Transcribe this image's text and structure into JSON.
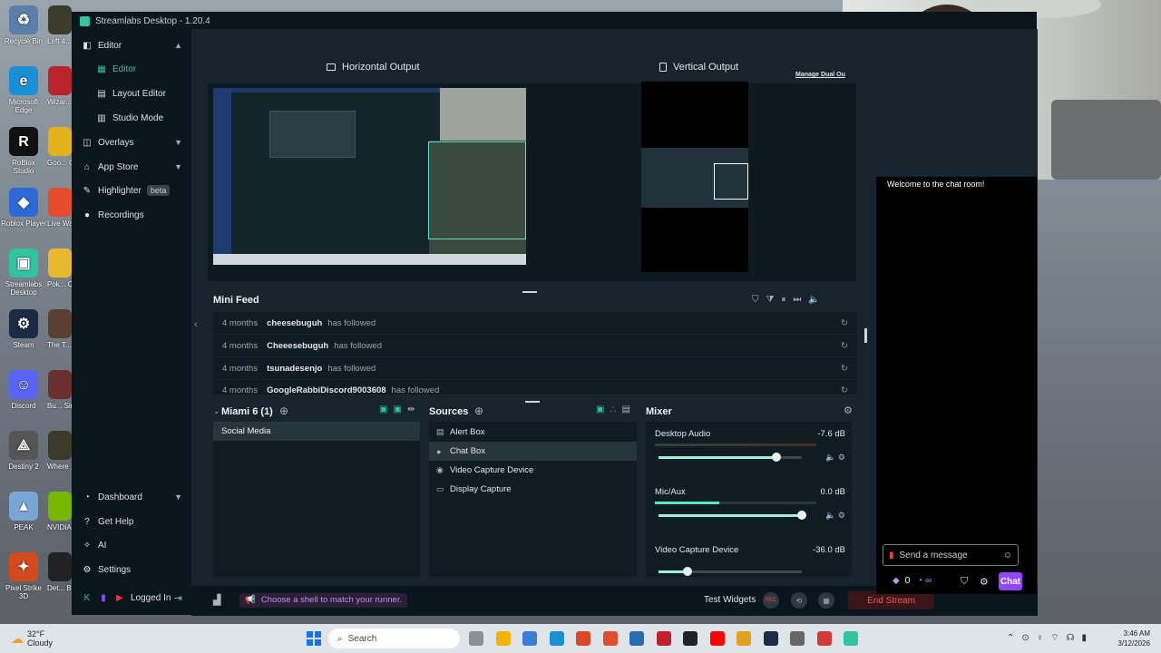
{
  "window": {
    "title": "Streamlabs Desktop - 1.20.4"
  },
  "desktop_icons": [
    {
      "label": "Recycle Bin",
      "color": "#5b7fa8",
      "glyph": "♻"
    },
    {
      "label": "Microsoft Edge",
      "color": "#1b8fd4",
      "glyph": "e"
    },
    {
      "label": "RoBlox Studio",
      "color": "#111111",
      "glyph": "R"
    },
    {
      "label": "Roblox Player",
      "color": "#2d6ad8",
      "glyph": "◆"
    },
    {
      "label": "Streamlabs Desktop",
      "color": "#31c3a2",
      "glyph": "▣"
    },
    {
      "label": "Steam",
      "color": "#1a2b43",
      "glyph": "⚙"
    },
    {
      "label": "Discord",
      "color": "#5865f2",
      "glyph": "☺"
    },
    {
      "label": "Destiny 2",
      "color": "#555555",
      "glyph": "⟁"
    },
    {
      "label": "PEAK",
      "color": "#7aa6d6",
      "glyph": "▲"
    },
    {
      "label": "Pixel Strike 3D",
      "color": "#d24a1e",
      "glyph": "✦"
    }
  ],
  "desktop_icons_col2": [
    {
      "label": "Left 4...",
      "color": "#3c3c2c"
    },
    {
      "label": "Wizar...",
      "color": "#b8242c"
    },
    {
      "label": "Goo... Chro...",
      "color": "#e2b21a"
    },
    {
      "label": "Live Wallp...",
      "color": "#e44c2c"
    },
    {
      "label": "Pok... Champ...",
      "color": "#e8b830"
    },
    {
      "label": "The T... Chain...",
      "color": "#5a4030"
    },
    {
      "label": "Bu... Simul...",
      "color": "#6a3030"
    },
    {
      "label": "Where ... M...",
      "color": "#3a3a2a"
    },
    {
      "label": "NVIDIA...",
      "color": "#76b900"
    },
    {
      "label": "Det... Beco...",
      "color": "#222222"
    }
  ],
  "sidebar": {
    "editor_section": "Editor",
    "items": [
      {
        "label": "Editor",
        "icon": "editor-icon"
      },
      {
        "label": "Layout Editor",
        "icon": "layout-icon"
      },
      {
        "label": "Studio Mode",
        "icon": "studio-icon"
      }
    ],
    "overlays": "Overlays",
    "app_store": "App Store",
    "highlighter": "Highlighter",
    "beta": "beta",
    "recordings": "Recordings",
    "dashboard": "Dashboard",
    "get_help": "Get Help",
    "ai": "AI",
    "settings": "Settings",
    "logged_in": "Logged In"
  },
  "outputs": {
    "horizontal": "Horizontal Output",
    "vertical": "Vertical Output",
    "manage": "Manage Dual Ou"
  },
  "mini_feed": {
    "title": "Mini Feed",
    "rows": [
      {
        "time": "4 months",
        "name": "cheesebuguh",
        "action": "has followed"
      },
      {
        "time": "4 months",
        "name": "Cheeesebuguh",
        "action": "has followed"
      },
      {
        "time": "4 months",
        "name": "tsunadesenjo",
        "action": "has followed"
      },
      {
        "time": "4 months",
        "name": "GoogleRabbiDiscord9003608",
        "action": "has followed"
      }
    ]
  },
  "scenes": {
    "title": "Miami 6 (1)",
    "items": [
      "Social Media"
    ]
  },
  "sources": {
    "title": "Sources",
    "items": [
      {
        "label": "Alert Box",
        "icon": "alert-box-icon"
      },
      {
        "label": "Chat Box",
        "icon": "chat-box-icon"
      },
      {
        "label": "Video Capture Device",
        "icon": "camera-icon"
      },
      {
        "label": "Display Capture",
        "icon": "monitor-icon"
      }
    ]
  },
  "mixer": {
    "title": "Mixer",
    "channels": [
      {
        "name": "Desktop Audio",
        "db": "-7.6 dB",
        "level": 0.82
      },
      {
        "name": "Mic/Aux",
        "db": "0.0 dB",
        "level": 1.0
      },
      {
        "name": "Video Capture Device",
        "db": "-36.0 dB",
        "level": 0.2
      }
    ]
  },
  "footer": {
    "runner": "Choose a shell to match your runner.",
    "test_widgets": "Test Widgets",
    "rec": "REC",
    "end_stream": "End Stream"
  },
  "chat": {
    "welcome": "Welcome to the chat room!",
    "placeholder": "Send a message",
    "points": "0",
    "chat_button": "Chat"
  },
  "taskbar": {
    "weather_temp": "32°F",
    "weather_desc": "Cloudy",
    "search": "Search",
    "time": "3:46 AM",
    "date": "3/12/2026"
  },
  "colors": {
    "accent": "#31c3a2",
    "end_stream": "#f05a5a",
    "purple": "#9146ff"
  }
}
